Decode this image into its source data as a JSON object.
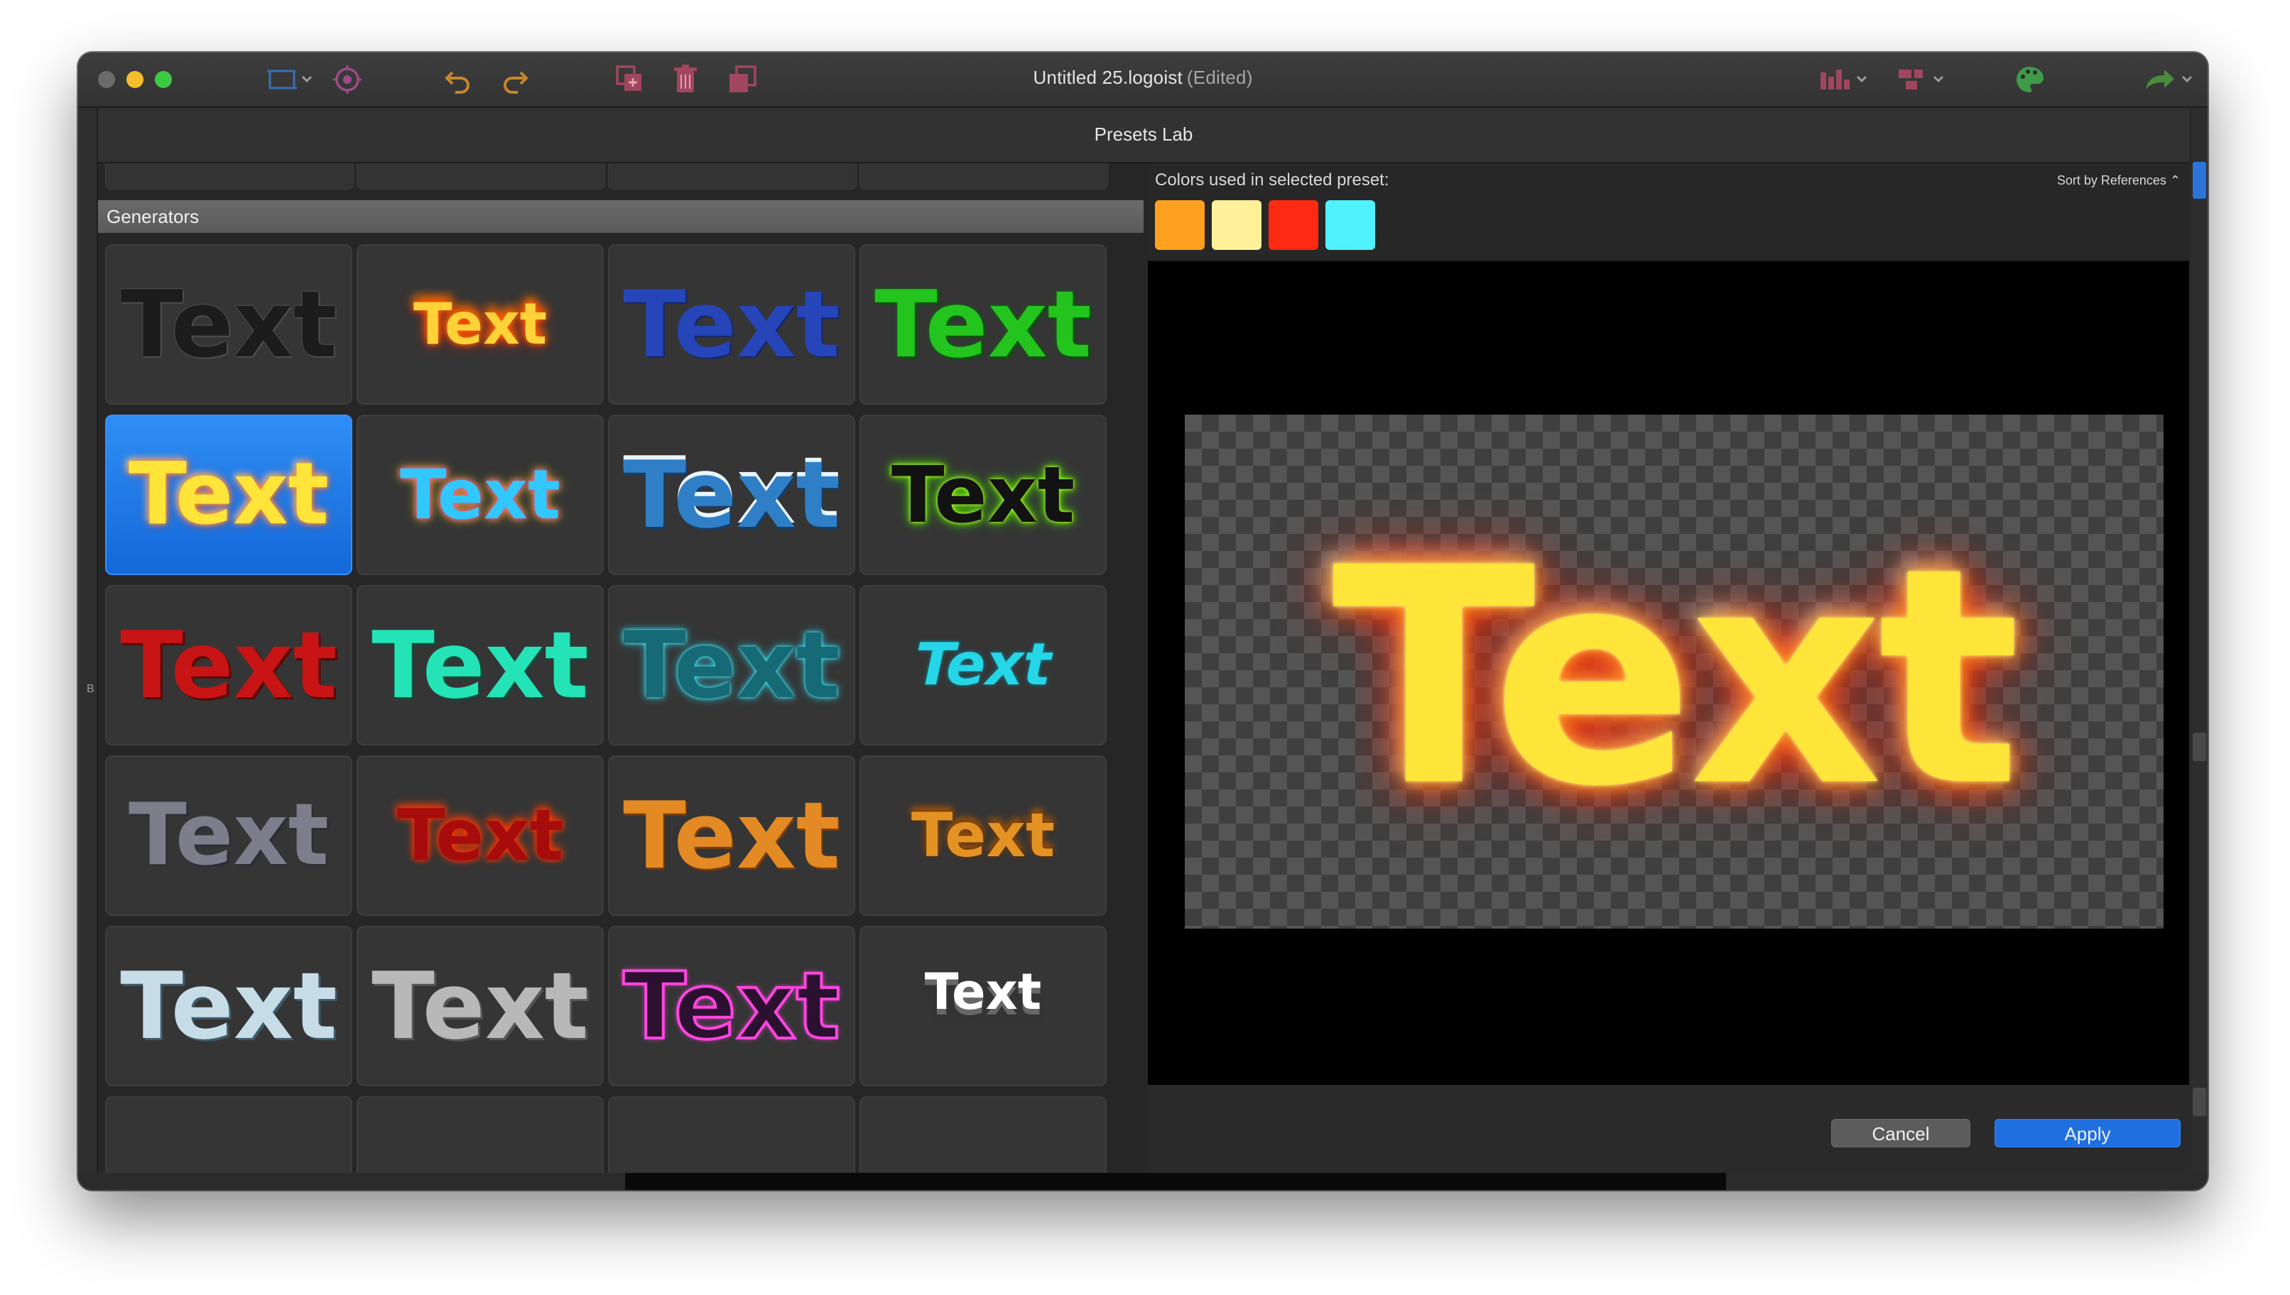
{
  "window": {
    "title": "Untitled 25.logoist",
    "title_suffix": "(Edited)"
  },
  "toolbar": {
    "left_icons": [
      "canvas-size-icon",
      "target-icon",
      "undo-icon",
      "redo-icon",
      "duplicate-icon",
      "trash-icon",
      "arrange-icon"
    ],
    "right_icons": [
      "chart-icon",
      "layers-icon",
      "palette-icon",
      "share-icon"
    ],
    "accent_color": "#a04a8a"
  },
  "left_strip_letter": "B",
  "dialog": {
    "title": "Presets Lab",
    "section_header": "Generators",
    "colors_label": "Colors used in selected preset:",
    "sort_label": "Sort by References",
    "swatches": [
      "#ffa11e",
      "#fff09a",
      "#ff2a12",
      "#4ff1ff"
    ],
    "preview_text": "Text",
    "cancel_label": "Cancel",
    "apply_label": "Apply"
  },
  "presets": [
    {
      "name": "preset-dark-dotted",
      "label": "Text"
    },
    {
      "name": "preset-fire-small",
      "label": "Text"
    },
    {
      "name": "preset-blue",
      "label": "Text"
    },
    {
      "name": "preset-green-grass",
      "label": "Text"
    },
    {
      "name": "preset-fire-glow",
      "label": "Text",
      "selected": true
    },
    {
      "name": "preset-rainbow",
      "label": "Text"
    },
    {
      "name": "preset-snow-blue",
      "label": "Text"
    },
    {
      "name": "preset-neon-green",
      "label": "Text"
    },
    {
      "name": "preset-red-dotted",
      "label": "Text"
    },
    {
      "name": "preset-cyan-dotted",
      "label": "Text"
    },
    {
      "name": "preset-cyan-glow",
      "label": "Text"
    },
    {
      "name": "preset-cyan-shatter",
      "label": "Text"
    },
    {
      "name": "preset-stone",
      "label": "Text"
    },
    {
      "name": "preset-red-fire",
      "label": "Text"
    },
    {
      "name": "preset-orange",
      "label": "Text"
    },
    {
      "name": "preset-orange-fire",
      "label": "Text"
    },
    {
      "name": "preset-silver",
      "label": "Text"
    },
    {
      "name": "preset-cracked",
      "label": "Text"
    },
    {
      "name": "preset-pink-outline",
      "label": "Text"
    },
    {
      "name": "preset-white-spiky",
      "label": "Text"
    }
  ]
}
